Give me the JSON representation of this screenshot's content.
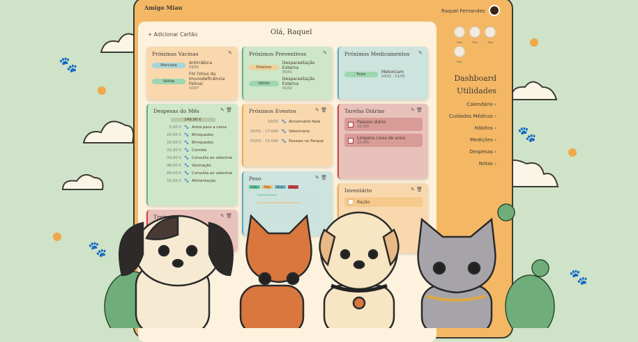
{
  "app": {
    "logo": "Amigo Miau",
    "user": "Raquel Fernandes",
    "greeting": "Olá, Raquel",
    "add_card": "Adicionar Cartão"
  },
  "pets": [
    "Gato",
    "Pluto",
    "Toby",
    "Miau"
  ],
  "nav": {
    "dashboard": "Dashboard",
    "utilities": "Utilidades",
    "items": [
      "Calendário",
      "Cuidados Médicos",
      "Hábitos",
      "Medições",
      "Despesas",
      "Notas"
    ]
  },
  "vaccines": {
    "title": "Próximas Vacinas",
    "items": [
      {
        "status": "Marcada",
        "name": "Antirrábica",
        "date": "03/01"
      },
      {
        "status": "Válida",
        "name": "FIV (Vírus da Imunodeficiência Felina)",
        "date": "10/07"
      }
    ]
  },
  "preventives": {
    "title": "Próximos Preventivos",
    "items": [
      {
        "status": "Próximo",
        "name": "Desparasitação Externa",
        "date": "05/01"
      },
      {
        "status": "Válido",
        "name": "Desparasitação Externa",
        "date": "01/02"
      }
    ]
  },
  "medications": {
    "title": "Próximos Medicamentos",
    "items": [
      {
        "status": "Feito",
        "name": "Meloxicam",
        "date": "04/01 - 01/05"
      }
    ]
  },
  "expenses": {
    "title": "Despesas do Mês",
    "total": "249,00 €",
    "items": [
      {
        "v": "5,00 €",
        "n": "Areia para a caixa"
      },
      {
        "v": "20,00 €",
        "n": "Brinquedos"
      },
      {
        "v": "16,00 €",
        "n": "Brinquedos"
      },
      {
        "v": "32,00 €",
        "n": "Comida"
      },
      {
        "v": "34,00 €",
        "n": "Consulta ao veterinário"
      },
      {
        "v": "48,00 €",
        "n": "Vacinação"
      },
      {
        "v": "80,00 €",
        "n": "Consulta ao veterinário"
      },
      {
        "v": "10,00 €",
        "n": "Alimentação"
      }
    ]
  },
  "events": {
    "title": "Próximos Eventos",
    "items": [
      {
        "t": "10/01",
        "n": "Aniversário Nala"
      },
      {
        "t": "20/01 - 17:00h",
        "n": "Veterinário"
      },
      {
        "t": "03/02 - 15:00h",
        "n": "Passeio no Parque"
      }
    ]
  },
  "tasks": {
    "title": "Tarefas Diárias",
    "items": [
      {
        "n": "Passeio diário",
        "t": "18:30h"
      },
      {
        "n": "Limpeza caixa de areia",
        "t": "22:00h"
      }
    ]
  },
  "weight": {
    "title": "Peso",
    "legend": [
      "Gato",
      "Toby",
      "Pluto",
      "Miau"
    ],
    "colors": [
      "#5cc79a",
      "#f5b865",
      "#6ab6d0",
      "#c8404a"
    ]
  },
  "inventory": {
    "title": "Inventário",
    "items": [
      "Ração"
    ]
  },
  "training": {
    "title": "Treinamento"
  }
}
